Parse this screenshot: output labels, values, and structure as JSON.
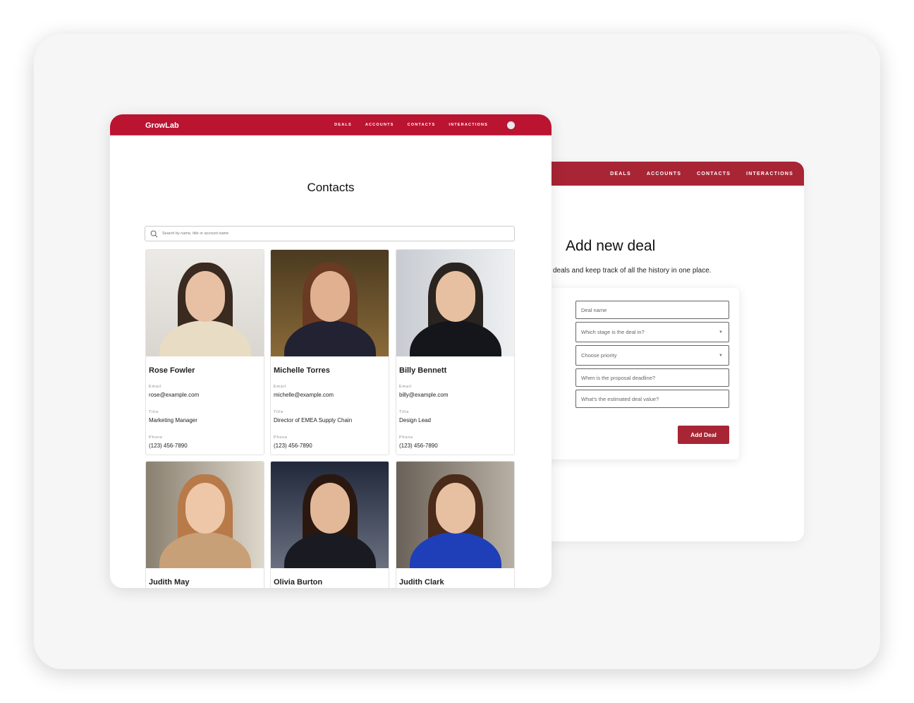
{
  "colors": {
    "front_header": "#ba1431",
    "back_header": "#a82535",
    "button": "#a82535"
  },
  "deal_window": {
    "nav": [
      "DEALS",
      "ACCOUNTS",
      "CONTACTS",
      "INTERACTIONS"
    ],
    "title": "Add new deal",
    "subtitle": "deals and keep track of all the history in one place.",
    "fields": [
      {
        "placeholder": "Deal name",
        "type": "text"
      },
      {
        "placeholder": "Which stage is the deal in?",
        "type": "select"
      },
      {
        "placeholder": "Choose priority",
        "type": "select"
      },
      {
        "placeholder": "When is the proposal deadline?",
        "type": "text"
      },
      {
        "placeholder": "What's the estimated deal value?",
        "type": "text"
      }
    ],
    "submit_label": "Add Deal"
  },
  "contacts_window": {
    "logo": "GrowLab",
    "nav": [
      "DEALS",
      "ACCOUNTS",
      "CONTACTS",
      "INTERACTIONS"
    ],
    "title": "Contacts",
    "search_placeholder": "Search by name, title or account name",
    "field_labels": {
      "email": "Email",
      "title": "Title",
      "phone": "Phone"
    },
    "contacts": [
      {
        "name": "Rose Fowler",
        "email": "rose@example.com",
        "title": "Marketing Manager",
        "phone": "(123) 456-7890"
      },
      {
        "name": "Michelle Torres",
        "email": "michelle@example.com",
        "title": "Director of EMEA Supply Chain",
        "phone": "(123) 456-7890"
      },
      {
        "name": "Billy Bennett",
        "email": "billy@example.com",
        "title": "Design Lead",
        "phone": "(123) 456-7890"
      },
      {
        "name": "Judith May"
      },
      {
        "name": "Olivia Burton"
      },
      {
        "name": "Judith Clark"
      }
    ]
  }
}
